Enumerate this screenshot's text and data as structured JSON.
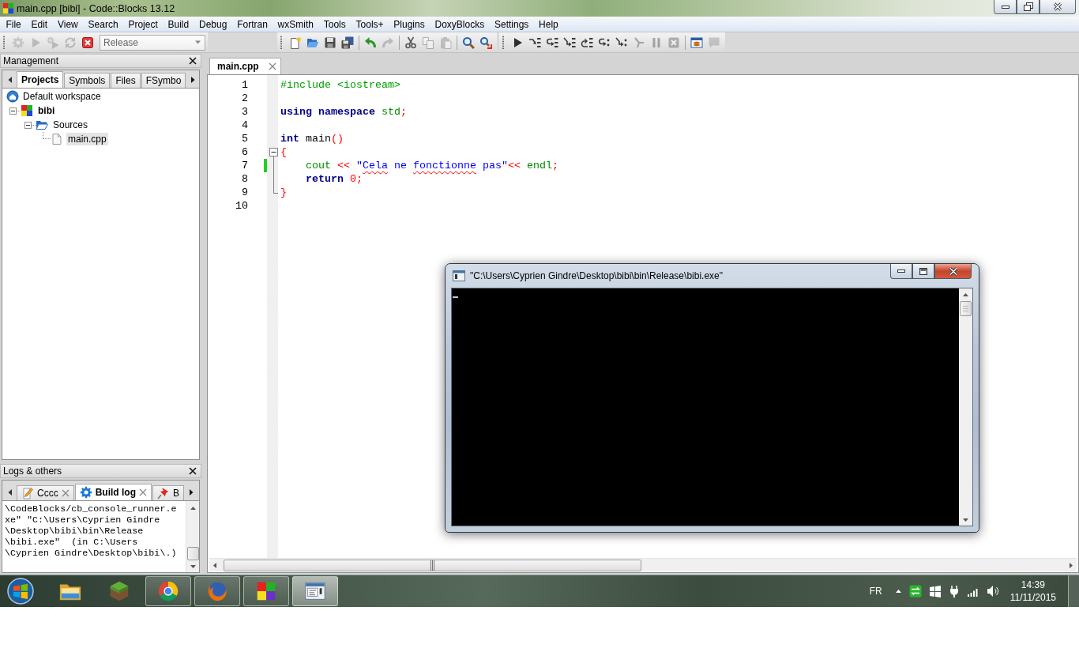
{
  "window": {
    "title": "main.cpp [bibi] - Code::Blocks 13.12"
  },
  "menu": [
    "File",
    "Edit",
    "View",
    "Search",
    "Project",
    "Build",
    "Debug",
    "Fortran",
    "wxSmith",
    "Tools",
    "Tools+",
    "Plugins",
    "DoxyBlocks",
    "Settings",
    "Help"
  ],
  "toolbars": [
    {
      "sections": [
        [
          {
            "kind": "build",
            "disabled": true
          },
          {
            "kind": "run",
            "disabled": true
          },
          {
            "kind": "build-run",
            "disabled": true
          },
          {
            "kind": "rebuild",
            "disabled": true
          },
          {
            "kind": "abort",
            "disabled": false
          }
        ]
      ],
      "build_target": "Release"
    },
    {
      "sections": [
        [
          {
            "kind": "new-file",
            "disabled": false
          },
          {
            "kind": "open",
            "disabled": false
          },
          {
            "kind": "save",
            "disabled": false
          },
          {
            "kind": "save-all",
            "disabled": false
          }
        ],
        [
          {
            "kind": "undo",
            "disabled": false
          },
          {
            "kind": "redo",
            "disabled": true
          }
        ],
        [
          {
            "kind": "cut",
            "disabled": false
          },
          {
            "kind": "copy",
            "disabled": true
          },
          {
            "kind": "paste",
            "disabled": true
          }
        ],
        [
          {
            "kind": "find",
            "disabled": false
          },
          {
            "kind": "replace",
            "disabled": false
          }
        ]
      ]
    },
    {
      "sections": [
        [
          {
            "kind": "debug",
            "disabled": false
          },
          {
            "kind": "run-to-cursor",
            "disabled": false
          },
          {
            "kind": "next-line",
            "disabled": false
          },
          {
            "kind": "step-into",
            "disabled": false
          },
          {
            "kind": "step-out",
            "disabled": false
          },
          {
            "kind": "next-instruction",
            "disabled": false
          },
          {
            "kind": "step-into-instruction",
            "disabled": false
          },
          {
            "kind": "break",
            "disabled": true
          },
          {
            "kind": "pause",
            "disabled": true
          },
          {
            "kind": "stop",
            "disabled": true
          }
        ],
        [
          {
            "kind": "debug-windows",
            "disabled": false
          },
          {
            "kind": "info",
            "disabled": true
          }
        ]
      ]
    }
  ],
  "management": {
    "title": "Management",
    "tabs": [
      {
        "label": "Projects",
        "selected": true
      },
      {
        "label": "Symbols",
        "selected": false
      },
      {
        "label": "Files",
        "selected": false
      },
      {
        "label": "FSymbo",
        "selected": false
      }
    ],
    "tree": [
      {
        "label": "Default workspace",
        "kind": "workspace",
        "selected": false,
        "active": false,
        "children": [
          {
            "label": "bibi",
            "kind": "project",
            "selected": false,
            "active": true,
            "expanded": true,
            "children": [
              {
                "label": "Sources",
                "kind": "folder",
                "selected": false,
                "active": false,
                "expanded": true,
                "children": [
                  {
                    "label": "main.cpp",
                    "kind": "file",
                    "selected": true,
                    "active": false
                  }
                ]
              }
            ]
          }
        ]
      }
    ]
  },
  "logs": {
    "title": "Logs & others",
    "tabs": [
      {
        "label": "Cccc",
        "kind": "notes",
        "selected": false,
        "closable": true
      },
      {
        "label": "Build log",
        "kind": "build-log",
        "selected": true,
        "closable": true
      },
      {
        "label": "B",
        "kind": "messages",
        "selected": false,
        "closable": false
      }
    ],
    "lines": [
      "\\CodeBlocks/cb_console_runner.e",
      "xe\" \"C:\\Users\\Cyprien Gindre",
      "\\Desktop\\bibi\\bin\\Release",
      "\\bibi.exe\"  (in C:\\Users",
      "\\Cyprien Gindre\\Desktop\\bibi\\.)"
    ]
  },
  "editor": {
    "tabs": [
      {
        "label": "main.cpp",
        "selected": true
      }
    ],
    "lines": [
      {
        "number": "1",
        "kind": "plain",
        "changed": false,
        "tokens": [
          {
            "text": "#include <iostream>",
            "kind": "preprocessor"
          }
        ]
      },
      {
        "number": "2",
        "kind": "plain",
        "changed": false
      },
      {
        "number": "3",
        "kind": "plain",
        "changed": false,
        "tokens": [
          {
            "text": "using namespace ",
            "kind": "keyword"
          },
          {
            "text": "std",
            "kind": "library"
          },
          {
            "text": ";",
            "kind": "operator"
          }
        ]
      },
      {
        "number": "4",
        "kind": "plain",
        "changed": false
      },
      {
        "number": "5",
        "kind": "plain",
        "changed": false,
        "tokens": [
          {
            "text": "int",
            "kind": "keyword"
          },
          {
            "text": " main",
            "kind": "plain"
          },
          {
            "text": "()",
            "kind": "operator"
          }
        ]
      },
      {
        "number": "6",
        "kind": "fold-start",
        "changed": false,
        "tokens": [
          {
            "text": "{",
            "kind": "operator"
          }
        ]
      },
      {
        "number": "7",
        "kind": "fold-body",
        "changed": true,
        "tokens": [
          {
            "text": "    cout",
            "kind": "library"
          },
          {
            "text": " << ",
            "kind": "operator"
          },
          {
            "text": "\"",
            "kind": "string",
            "misspelled": false
          },
          {
            "text": "Cela",
            "kind": "string",
            "misspelled": true
          },
          {
            "text": " ne ",
            "kind": "string",
            "misspelled": false
          },
          {
            "text": "fonctionne",
            "kind": "string",
            "misspelled": true
          },
          {
            "text": " pas\"",
            "kind": "string",
            "misspelled": false
          },
          {
            "text": "<< ",
            "kind": "operator"
          },
          {
            "text": "endl",
            "kind": "library"
          },
          {
            "text": ";",
            "kind": "operator"
          }
        ]
      },
      {
        "number": "8",
        "kind": "fold-body",
        "changed": false,
        "tokens": [
          {
            "text": "    return ",
            "kind": "keyword"
          },
          {
            "text": "0",
            "kind": "number"
          },
          {
            "text": ";",
            "kind": "operator"
          }
        ]
      },
      {
        "number": "9",
        "kind": "fold-end",
        "changed": false,
        "tokens": [
          {
            "text": "}",
            "kind": "operator"
          }
        ]
      },
      {
        "number": "10",
        "kind": "plain",
        "changed": false
      }
    ]
  },
  "console": {
    "title": "\"C:\\Users\\Cyprien Gindre\\Desktop\\bibi\\bin\\Release\\bibi.exe\""
  },
  "taskbar": {
    "buttons": [
      {
        "kind": "folder",
        "running": false,
        "selected": false
      },
      {
        "kind": "cube",
        "running": false,
        "selected": false
      },
      {
        "kind": "segmented-circle",
        "running": true,
        "selected": false
      },
      {
        "kind": "globe",
        "running": true,
        "selected": false
      },
      {
        "kind": "squares",
        "running": true,
        "selected": false
      },
      {
        "kind": "console",
        "running": true,
        "selected": true
      }
    ],
    "language": "FR",
    "time": "14:39",
    "date": "11/11/2015"
  }
}
